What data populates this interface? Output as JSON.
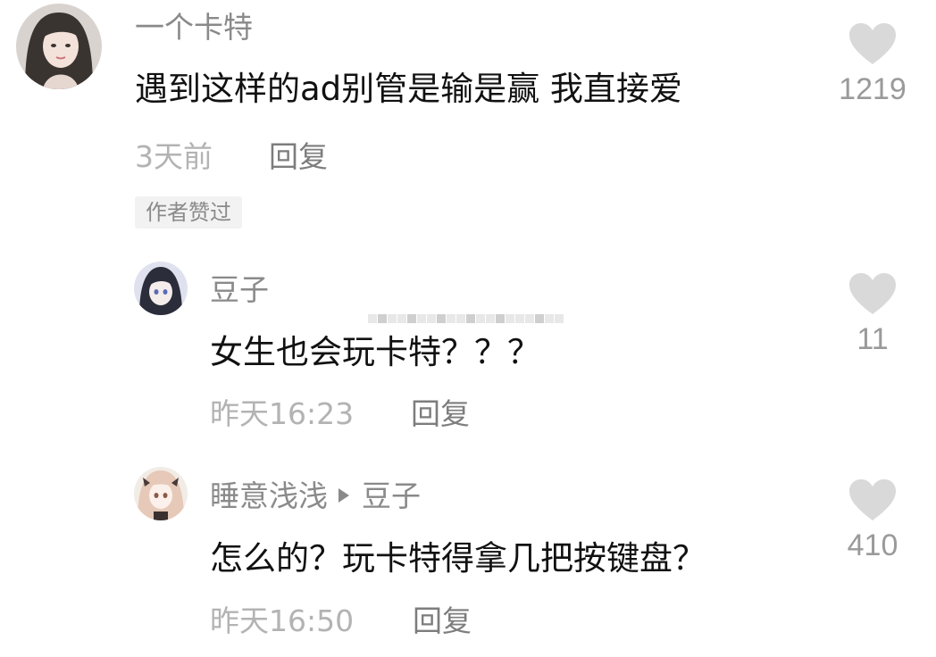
{
  "colors": {
    "username": "#8a8a8a",
    "content": "#111111",
    "meta": "#b3b3b3",
    "heart": "#d9d9d9",
    "badge_bg": "#f2f2f2"
  },
  "comments": [
    {
      "username": "一个卡特",
      "content": "遇到这样的ad别管是输是赢 我直接爱",
      "time": "3天前",
      "reply_label": "回复",
      "badge": "作者赞过",
      "likes": "1219",
      "like_icon": "heart-icon"
    },
    {
      "username": "豆子",
      "content": "女生也会玩卡特？？？",
      "time": "昨天16:23",
      "reply_label": "回复",
      "likes": "11",
      "like_icon": "heart-icon"
    },
    {
      "username": "睡意浅浅",
      "reply_to": "豆子",
      "content": "怎么的？玩卡特得拿几把按键盘？",
      "time": "昨天16:50",
      "reply_label": "回复",
      "likes": "410",
      "like_icon": "heart-icon"
    }
  ]
}
